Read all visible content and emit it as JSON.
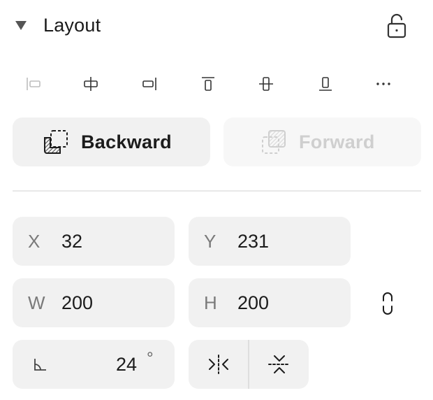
{
  "section": {
    "title": "Layout",
    "collapse_icon": "triangle-down-icon",
    "lock_icon": "unlock-icon"
  },
  "alignment": [
    {
      "name": "align-left",
      "icon": "align-left-icon",
      "enabled": false
    },
    {
      "name": "align-horizontal-center",
      "icon": "align-horizontal-center-icon",
      "enabled": true
    },
    {
      "name": "align-right",
      "icon": "align-right-icon",
      "enabled": true
    },
    {
      "name": "align-top",
      "icon": "align-top-icon",
      "enabled": true
    },
    {
      "name": "align-vertical-center",
      "icon": "align-vertical-center-icon",
      "enabled": true
    },
    {
      "name": "align-bottom",
      "icon": "align-bottom-icon",
      "enabled": true
    },
    {
      "name": "more",
      "icon": "more-horizontal-icon",
      "enabled": true
    }
  ],
  "order": {
    "backward_label": "Backward",
    "forward_label": "Forward",
    "forward_enabled": false
  },
  "position": {
    "x_label": "X",
    "x_value": "32",
    "y_label": "Y",
    "y_value": "231"
  },
  "size": {
    "w_label": "W",
    "w_value": "200",
    "h_label": "H",
    "h_value": "200",
    "link_icon": "link-icon"
  },
  "rotation": {
    "icon": "angle-icon",
    "value": "24",
    "unit": "°"
  },
  "flip": {
    "horizontal_icon": "flip-horizontal-icon",
    "vertical_icon": "flip-vertical-icon"
  },
  "colors": {
    "field_bg": "#f1f1f1",
    "text": "#1c1c1c",
    "muted": "#7a7a7a",
    "disabled": "#cfcfcf"
  }
}
